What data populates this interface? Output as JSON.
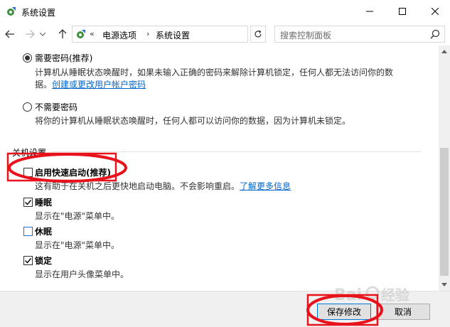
{
  "window": {
    "title": "系统设置",
    "controls": {
      "minimize": "—",
      "maximize": "☐",
      "close": "✕"
    }
  },
  "navigation": {
    "back_icon": "arrow-left-icon",
    "forward_icon": "arrow-right-icon",
    "up_icon": "arrow-up-icon",
    "breadcrumb_chevron": "«",
    "breadcrumbs": [
      "电源选项",
      "系统设置"
    ],
    "separator": "›",
    "refresh_icon": "refresh-icon",
    "search_placeholder": "搜索控制面板"
  },
  "password_options": [
    {
      "label": "需要密码(推荐)",
      "selected": true,
      "description": "计算机从睡眠状态唤醒时，如果未输入正确的密码来解除计算机锁定，任何人都无法访问你的数",
      "description_line2": "据。",
      "link": "创建或更改用户帐户密码"
    },
    {
      "label": "不需要密码",
      "selected": false,
      "description": "将你的计算机从睡眠状态唤醒时，任何人都可以访问你的数据，因为计算机未锁定。"
    }
  ],
  "shutdown_settings": {
    "heading": "关机设置",
    "items": [
      {
        "label": "启用快速启动(推荐)",
        "checked": false,
        "description": "这有助于在关机之后更快地启动电脑。不会影响重启。",
        "link": "了解更多信息"
      },
      {
        "label": "睡眠",
        "checked": true,
        "description": "显示在\"电源\"菜单中。"
      },
      {
        "label": "休眠",
        "checked": false,
        "description": "显示在\"电源\"菜单中。"
      },
      {
        "label": "锁定",
        "checked": true,
        "description": "显示在用户头像菜单中。"
      }
    ]
  },
  "buttons": {
    "save": "保存修改",
    "cancel": "取消"
  },
  "watermark": "Baidu 经验",
  "colors": {
    "link": "#0066cc",
    "annotation": "#e8121c"
  }
}
